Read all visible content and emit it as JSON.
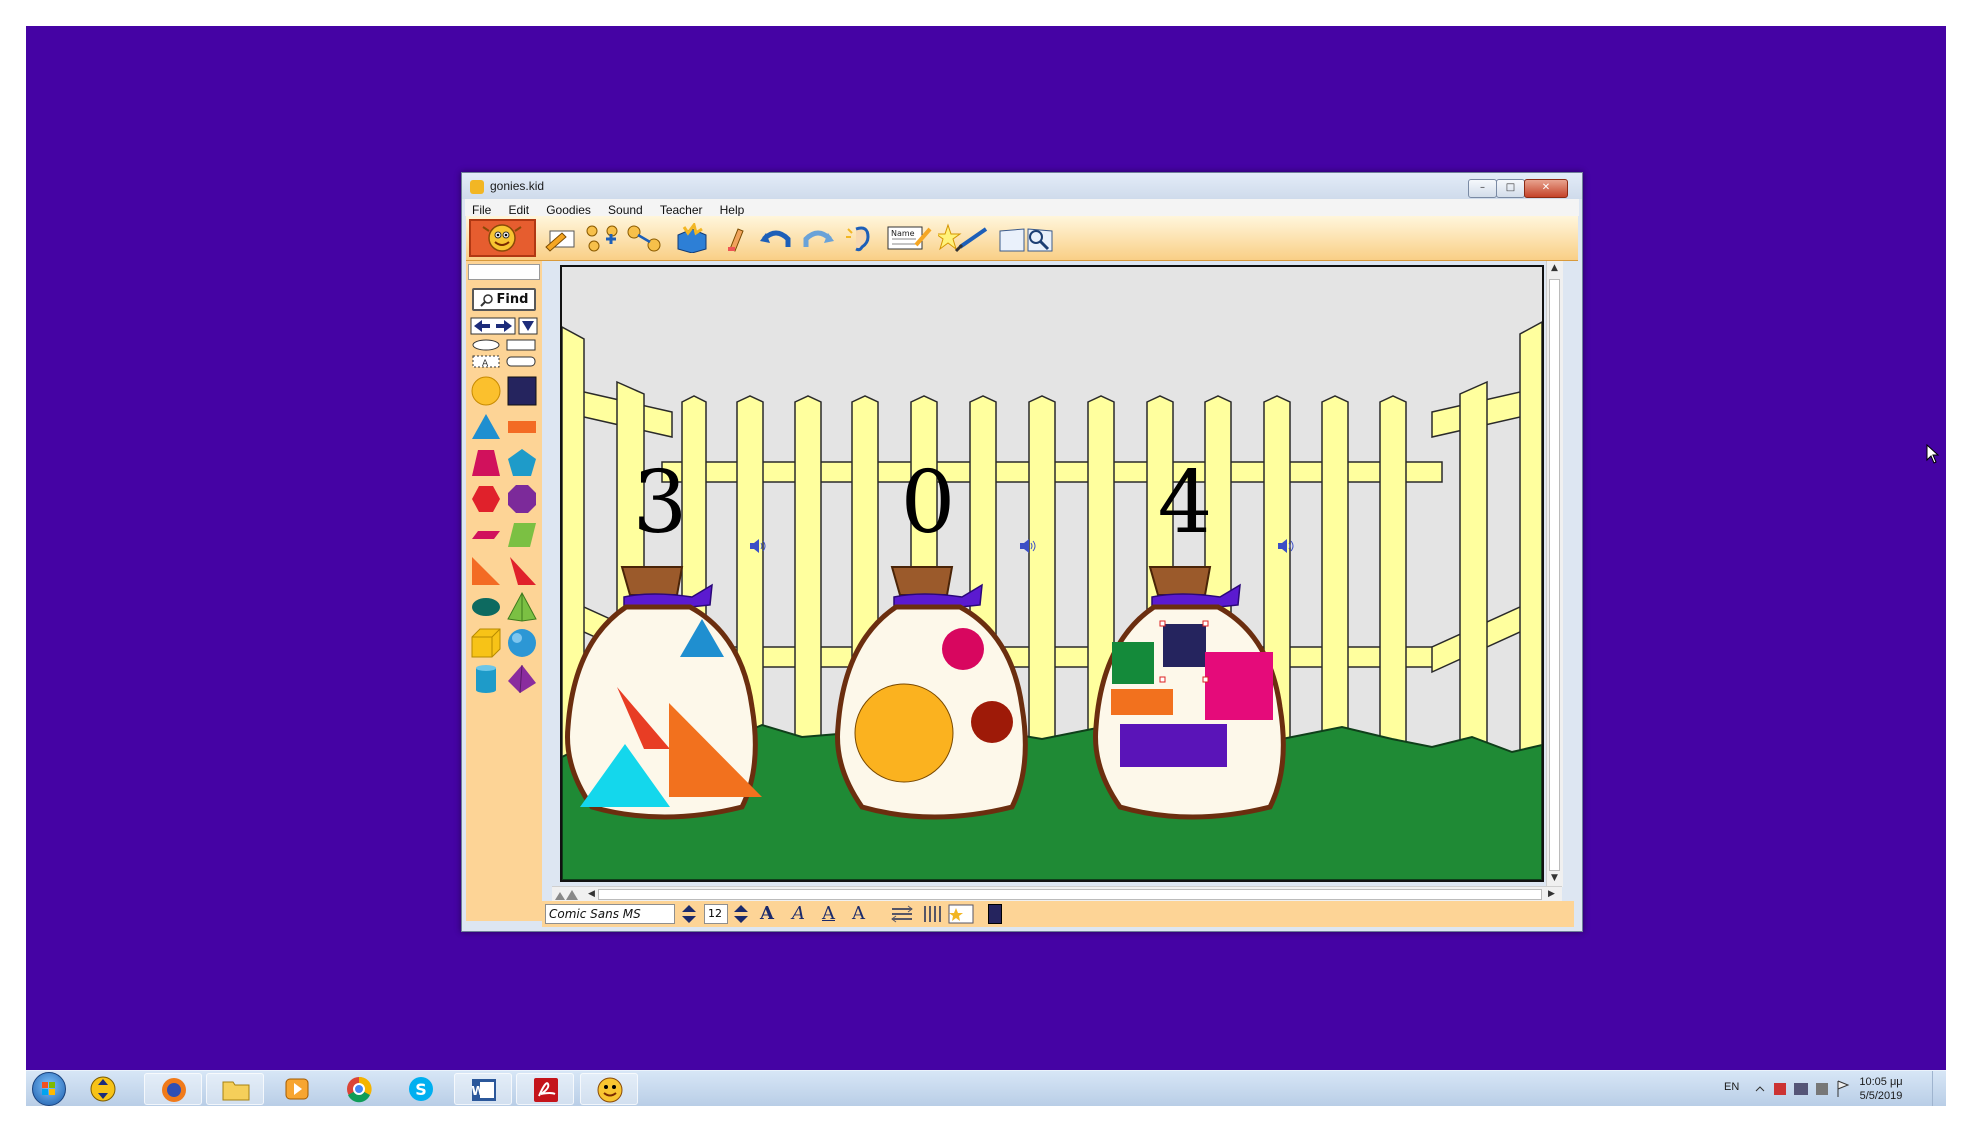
{
  "window": {
    "title": "gonies.kid",
    "controls": {
      "minimize": "–",
      "maximize": "□",
      "close": "✕"
    }
  },
  "menu": [
    "File",
    "Edit",
    "Goodies",
    "Sound",
    "Teacher",
    "Help"
  ],
  "toolbar": {
    "buttons": [
      "pencil-tool",
      "node-add-tool",
      "link-tool",
      "goodies-box",
      "eraser-tool",
      "undo",
      "redo",
      "listen-ear",
      "name-tag",
      "star-wand",
      "brush-tool",
      "book-zoom"
    ],
    "name_tag_label": "Name"
  },
  "palette": {
    "find_label": "Find",
    "text_tool_label": "A"
  },
  "canvas": {
    "bags": [
      {
        "number": "3",
        "shapes": [
          "red triangle",
          "blue triangle",
          "orange triangle",
          "cyan triangle"
        ]
      },
      {
        "number": "0",
        "shapes": [
          "magenta circle",
          "yellow circle",
          "dark red circle"
        ]
      },
      {
        "number": "4",
        "shapes": [
          "green square",
          "navy square",
          "pink square",
          "orange rectangle",
          "purple rectangle"
        ]
      }
    ]
  },
  "format_bar": {
    "font": "Comic Sans MS",
    "size": "12",
    "bold": "A",
    "italic": "A",
    "underline": "A",
    "superscript": "A"
  },
  "taskbar": {
    "language": "EN",
    "time": "10:05 μμ",
    "date": "5/5/2019",
    "apps": [
      "start",
      "transfer",
      "firefox",
      "explorer",
      "media-player",
      "chrome",
      "skype",
      "word",
      "acrobat",
      "kidspiration"
    ]
  },
  "colors": {
    "desktop": "#4503a4",
    "fence": "#ffff9e",
    "grass": "#1f8a35",
    "bag_fill": "#fdf8ea",
    "bag_outline": "#6b2e0f",
    "bag_tie": "#5b1ad0",
    "palette_bg": "#fdd496"
  }
}
